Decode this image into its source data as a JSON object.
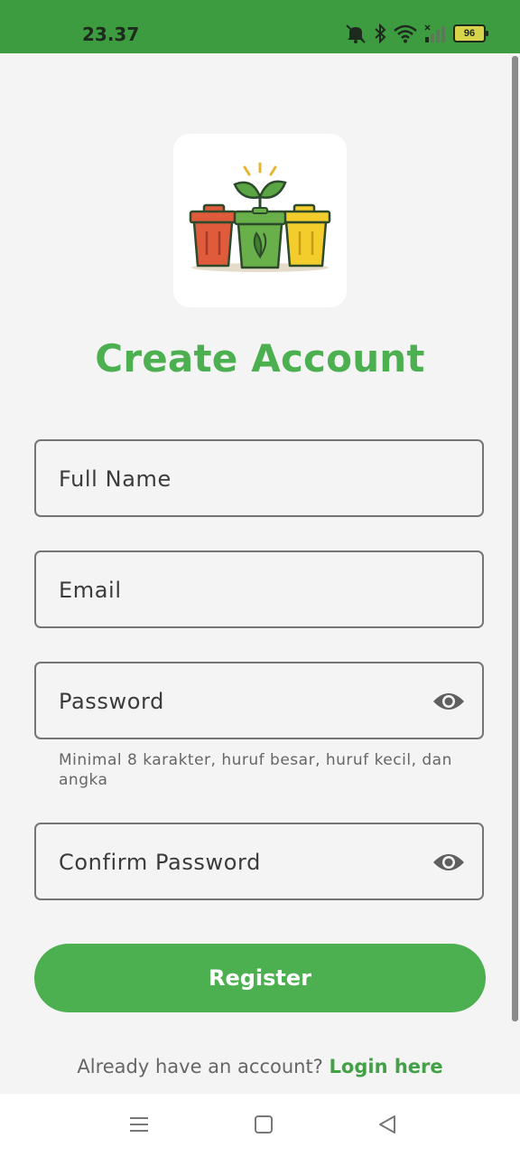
{
  "status_bar": {
    "time": "23.37",
    "battery_level": "96",
    "icons": [
      "mute-icon",
      "bluetooth-icon",
      "wifi-icon",
      "signal-icon",
      "battery-icon"
    ],
    "background_color": "#3d9b40"
  },
  "logo": {
    "icon": "recycle-bins-plant-logo"
  },
  "title": "Create Account",
  "form": {
    "full_name_label": "Full Name",
    "email_label": "Email",
    "password_label": "Password",
    "password_helper": "Minimal 8 karakter, huruf besar, huruf kecil, dan angka",
    "confirm_password_label": "Confirm Password"
  },
  "register_button": "Register",
  "footer": {
    "prompt": "Already have an account?",
    "login_link": "Login here"
  },
  "colors": {
    "accent": "#4caf50",
    "link": "#43a047"
  },
  "nav_bar": {
    "icons": [
      "menu-icon",
      "home-square-icon",
      "back-triangle-icon"
    ]
  }
}
